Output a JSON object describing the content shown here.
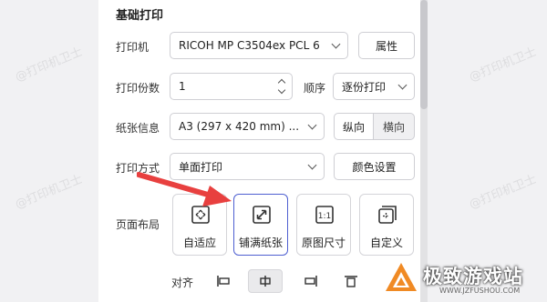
{
  "section_title": "基础打印",
  "printer": {
    "label": "打印机",
    "value": "RICOH MP C3504ex PCL 6",
    "props_button": "属性"
  },
  "copies": {
    "label": "打印份数",
    "value": "1",
    "order_label": "顺序",
    "order_value": "逐份打印"
  },
  "paper": {
    "label": "纸张信息",
    "value": "A3 (297 x 420 mm) ...",
    "portrait": "纵向",
    "landscape": "横向",
    "selected_orientation": "portrait"
  },
  "print_mode": {
    "label": "打印方式",
    "value": "单面打印",
    "color_button": "颜色设置"
  },
  "page_layout": {
    "label": "页面布局",
    "options": [
      {
        "label": "自适应",
        "icon": "fit-page-icon",
        "selected": false
      },
      {
        "label": "铺满纸张",
        "icon": "fill-paper-icon",
        "selected": true
      },
      {
        "label": "原图尺寸",
        "icon": "actual-size-icon",
        "selected": false
      },
      {
        "label": "自定义",
        "icon": "custom-size-icon",
        "selected": false
      }
    ]
  },
  "align": {
    "label": "对齐",
    "options": [
      {
        "icon": "align-left-icon",
        "selected": false
      },
      {
        "icon": "align-center-icon",
        "selected": true
      },
      {
        "icon": "align-right-icon",
        "selected": false
      },
      {
        "icon": "align-top-icon",
        "selected": false
      }
    ]
  },
  "watermark_text": "@打印机卫士",
  "brand": {
    "name": "极致游戏站",
    "url": "WWW.JZFUSHOU.COM"
  },
  "colors": {
    "accent": "#4e5fd1",
    "arrow": "#e8403f",
    "brand_orange": "#f08a24"
  }
}
